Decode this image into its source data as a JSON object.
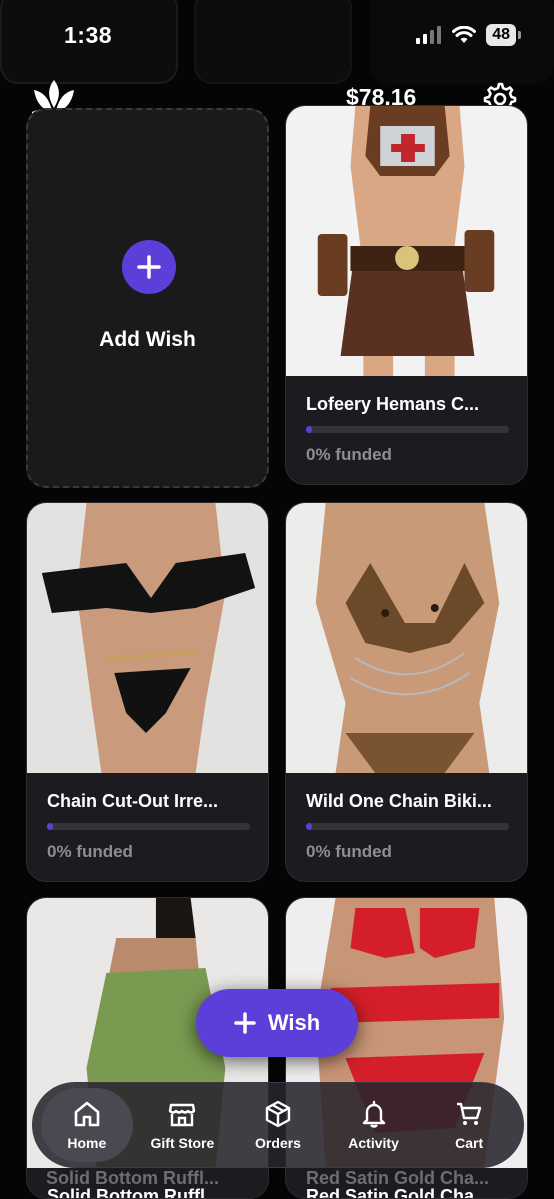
{
  "status_bar": {
    "time": "1:38",
    "battery": "48"
  },
  "header": {
    "balance": "$78.16"
  },
  "add_card": {
    "label": "Add Wish"
  },
  "wishes": [
    {
      "title": "Lofeery Hemans C...",
      "funded": "0% funded",
      "progress": 0.0
    },
    {
      "title": "Chain Cut-Out Irre...",
      "funded": "0% funded",
      "progress": 0.0
    },
    {
      "title": "Wild One Chain Biki...",
      "funded": "0% funded",
      "progress": 0.0
    },
    {
      "title": "Solid Bottom Ruffl...",
      "funded": "",
      "progress": 0.0
    },
    {
      "title": "Red Satin Gold Cha...",
      "funded": "",
      "progress": 0.0
    }
  ],
  "wish_button": {
    "label": "Wish"
  },
  "tabs": [
    {
      "label": "Home",
      "icon": "home-icon",
      "active": true
    },
    {
      "label": "Gift Store",
      "icon": "store-icon"
    },
    {
      "label": "Orders",
      "icon": "box-icon"
    },
    {
      "label": "Activity",
      "icon": "bell-icon"
    },
    {
      "label": "Cart",
      "icon": "cart-icon"
    }
  ],
  "colors": {
    "accent": "#5b3fd8",
    "card": "#1c1b1f",
    "background": "#050505"
  }
}
